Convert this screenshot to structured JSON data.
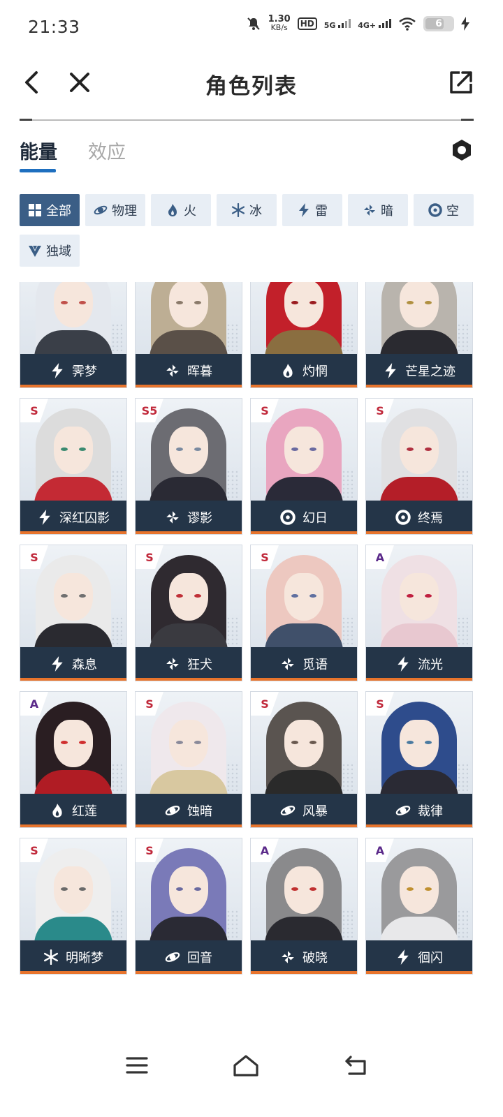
{
  "status_bar": {
    "time": "21:33",
    "net_speed_value": "1.30",
    "net_speed_unit": "KB/s",
    "hd_label": "HD",
    "signal_1": "5G",
    "signal_2": "4G+",
    "battery_level": "6",
    "icons": [
      "mute-icon",
      "hd-icon",
      "signal-5g-icon",
      "signal-4g-icon",
      "wifi-icon",
      "battery-icon",
      "charging-icon"
    ]
  },
  "header": {
    "title": "角色列表",
    "icons": [
      "back-icon",
      "close-icon",
      "share-icon"
    ]
  },
  "tabs": [
    {
      "label": "能量",
      "active": true
    },
    {
      "label": "效应",
      "active": false
    }
  ],
  "filters": [
    {
      "label": "全部",
      "icon": "grid-icon",
      "active": true
    },
    {
      "label": "物理",
      "icon": "physical-icon"
    },
    {
      "label": "火",
      "icon": "fire-icon"
    },
    {
      "label": "冰",
      "icon": "ice-icon"
    },
    {
      "label": "雷",
      "icon": "thunder-icon"
    },
    {
      "label": "暗",
      "icon": "dark-icon"
    },
    {
      "label": "空",
      "icon": "void-icon"
    },
    {
      "label": "独域",
      "icon": "unique-icon"
    }
  ],
  "characters": [
    {
      "name": "霁梦",
      "rank": "",
      "element": "thunder"
    },
    {
      "name": "晖暮",
      "rank": "",
      "element": "dark"
    },
    {
      "name": "灼惘",
      "rank": "",
      "element": "fire"
    },
    {
      "name": "芒星之迹",
      "rank": "",
      "element": "thunder"
    },
    {
      "name": "深红囚影",
      "rank": "S",
      "element": "thunder"
    },
    {
      "name": "谬影",
      "rank": "S5",
      "element": "dark"
    },
    {
      "name": "幻日",
      "rank": "S",
      "element": "void"
    },
    {
      "name": "终焉",
      "rank": "S",
      "element": "void"
    },
    {
      "name": "森息",
      "rank": "S",
      "element": "thunder"
    },
    {
      "name": "狂犬",
      "rank": "S",
      "element": "dark"
    },
    {
      "name": "觅语",
      "rank": "S",
      "element": "dark"
    },
    {
      "name": "流光",
      "rank": "A",
      "element": "thunder"
    },
    {
      "name": "红莲",
      "rank": "A",
      "element": "fire"
    },
    {
      "name": "蚀暗",
      "rank": "S",
      "element": "physical"
    },
    {
      "name": "风暴",
      "rank": "S",
      "element": "physical"
    },
    {
      "name": "裁律",
      "rank": "S",
      "element": "physical"
    },
    {
      "name": "明晰梦",
      "rank": "S",
      "element": "ice"
    },
    {
      "name": "回音",
      "rank": "S",
      "element": "physical"
    },
    {
      "name": "破晓",
      "rank": "A",
      "element": "dark"
    },
    {
      "name": "徊闪",
      "rank": "A",
      "element": "thunder"
    }
  ],
  "portrait_palette": [
    {
      "hair": "#e4e8ee",
      "outfit": "#3a3f48",
      "eye": "#c0504a"
    },
    {
      "hair": "#bdae94",
      "outfit": "#5a5048",
      "eye": "#8a7a6a"
    },
    {
      "hair": "#c2202a",
      "outfit": "#8a6e40",
      "eye": "#9a1c20"
    },
    {
      "hair": "#b9b4ad",
      "outfit": "#2a2a30",
      "eye": "#b09040"
    },
    {
      "hair": "#dcdcdc",
      "outfit": "#c42a34",
      "eye": "#3a8a70"
    },
    {
      "hair": "#6c6c72",
      "outfit": "#2a2a34",
      "eye": "#7a8aa0"
    },
    {
      "hair": "#e9a6c0",
      "outfit": "#2a2a38",
      "eye": "#6a6aa0"
    },
    {
      "hair": "#e0e0e2",
      "outfit": "#b41e28",
      "eye": "#b03040"
    },
    {
      "hair": "#eaeaea",
      "outfit": "#2a2a30",
      "eye": "#707070"
    },
    {
      "hair": "#2f2a30",
      "outfit": "#3a3a40",
      "eye": "#c03038"
    },
    {
      "hair": "#edc8c0",
      "outfit": "#40506a",
      "eye": "#6070a0"
    },
    {
      "hair": "#efe0e4",
      "outfit": "#e8c8d0",
      "eye": "#c02040"
    },
    {
      "hair": "#2a1e22",
      "outfit": "#b01c24",
      "eye": "#d03030"
    },
    {
      "hair": "#efe8ec",
      "outfit": "#d8c8a0",
      "eye": "#8a8a9a"
    },
    {
      "hair": "#5a5450",
      "outfit": "#2a2a2a",
      "eye": "#6a5a50"
    },
    {
      "hair": "#2e4c8c",
      "outfit": "#2a2a34",
      "eye": "#4a7aa0"
    },
    {
      "hair": "#eeeeee",
      "outfit": "#2a8a8a",
      "eye": "#6a6a6a"
    },
    {
      "hair": "#7a7ab8",
      "outfit": "#2a2a34",
      "eye": "#6a6aa0"
    },
    {
      "hair": "#8a8a8c",
      "outfit": "#2a2a30",
      "eye": "#c03030"
    },
    {
      "hair": "#9a9a9c",
      "outfit": "#e8e8ea",
      "eye": "#c09030"
    }
  ],
  "bottom_nav": [
    {
      "icon": "menu-icon"
    },
    {
      "icon": "home-icon"
    },
    {
      "icon": "back-nav-icon"
    }
  ],
  "colors": {
    "accent": "#1e6fbf",
    "chip_active": "#3b5e86",
    "chip_inactive": "#e8eef5",
    "namebar": "#243548",
    "namebar_stripe": "#e8742c",
    "rank_s": "#c0283a",
    "rank_a": "#5b2a8a"
  }
}
